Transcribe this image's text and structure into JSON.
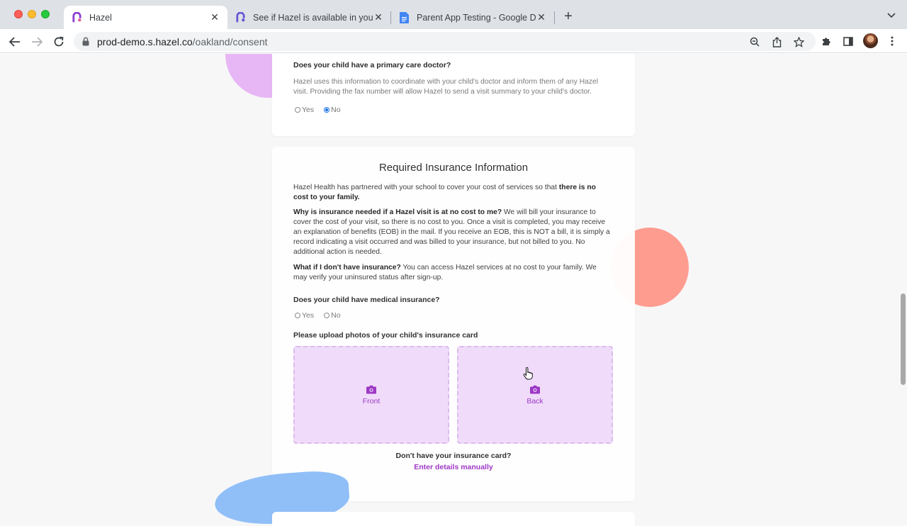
{
  "browser": {
    "tabs": [
      {
        "title": "Hazel",
        "active": true
      },
      {
        "title": "See if Hazel is available in your",
        "active": false
      },
      {
        "title": "Parent App Testing - Google Do",
        "active": false
      }
    ],
    "url_host": "prod-demo.s.hazel.co",
    "url_path": "/oakland/consent"
  },
  "primary_care": {
    "question": "Does your child have a primary care doctor?",
    "description": "Hazel uses this information to coordinate with your child's doctor and inform them of any Hazel visit. Providing the fax number will allow Hazel to send a visit summary to your child's doctor.",
    "options": [
      "Yes",
      "No"
    ],
    "selected": "No"
  },
  "insurance": {
    "heading": "Required Insurance Information",
    "intro": "Hazel Health has partnered with your school to cover your cost of services so that ",
    "intro_bold": "there is no cost to your family.",
    "why_q": "Why is insurance needed if a Hazel visit is at no cost to me?",
    "why_a": " We will bill your insurance to cover the cost of your visit, so there is no cost to you. Once a visit is completed, you may receive an explanation of benefits (EOB) in the mail. If you receive an EOB, this is NOT a bill, it is simply a record indicating a visit occurred and was billed to your insurance, but not billed to you. No additional action is needed.",
    "no_ins_q": "What if I don't have insurance?",
    "no_ins_a": " You can access Hazel services at no cost to your family. We may verify your uninsured status after sign-up.",
    "medical_q": "Does your child have medical insurance?",
    "options": [
      "Yes",
      "No"
    ],
    "selected": "",
    "upload_prompt": "Please upload photos of your child's insurance card",
    "front_label": "Front",
    "back_label": "Back",
    "no_card": "Don't have your insurance card?",
    "manual_link": "Enter details manually"
  },
  "colors": {
    "accent": "#9b32c4",
    "upload_bg": "#f0dcfb",
    "radio_selected": "#1a73e8"
  }
}
